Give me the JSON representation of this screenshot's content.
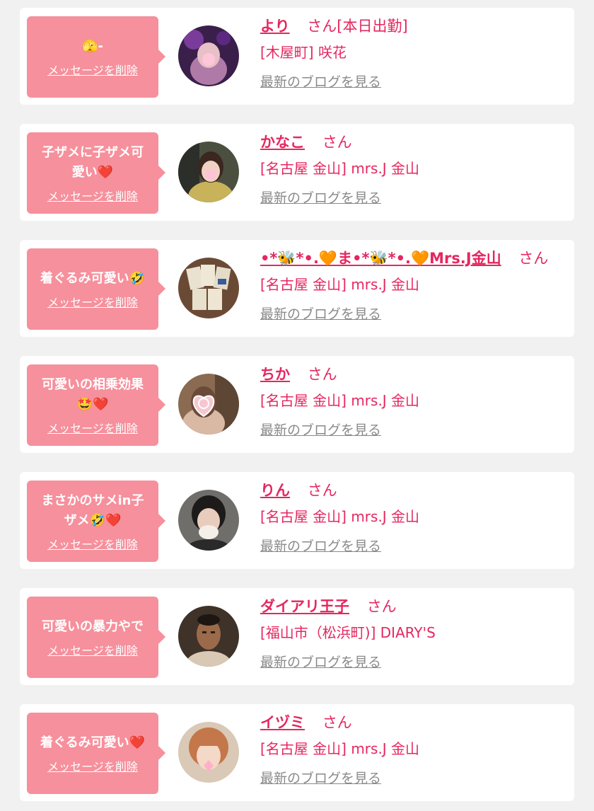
{
  "colors": {
    "accent": "#e5275f",
    "bubble": "#f6909c",
    "background": "#f1f1f1",
    "card": "#ffffff",
    "link_gray": "#8a8a8a"
  },
  "delete_label": "メッセージを削除",
  "blog_label": "最新のブログを見る",
  "san_label": "さん",
  "cards": [
    {
      "message": "🫣-",
      "name": "より",
      "name_suffix": "さん[本日出勤]",
      "shop": "[木屋町] 咲花",
      "avatar": "avatar-photo-purple"
    },
    {
      "message": "子ザメに子ザメ可愛い❤️",
      "name": "かなこ",
      "name_suffix": "さん",
      "shop": "[名古屋 金山] mrs.J 金山",
      "avatar": "avatar-photo-woman"
    },
    {
      "message": "着ぐるみ可愛い🤣",
      "name": "•*🐝*•.🧡ま•*🐝*•.🧡Mrs.J金山",
      "name_suffix": "さん",
      "shop": "[名古屋 金山] mrs.J 金山",
      "avatar": "avatar-photo-cards"
    },
    {
      "message": "可愛いの相乗効果🤩❤️",
      "name": "ちか",
      "name_suffix": "さん",
      "shop": "[名古屋 金山] mrs.J 金山",
      "avatar": "avatar-photo-heart-c"
    },
    {
      "message": "まさかのサメin子ザメ🤣❤️",
      "name": "りん",
      "name_suffix": "さん",
      "shop": "[名古屋 金山] mrs.J 金山",
      "avatar": "avatar-photo-ng"
    },
    {
      "message": "可愛いの暴力やで",
      "name": "ダイアリ王子",
      "name_suffix": "さん",
      "shop": "[福山市（松浜町)] DIARY'S",
      "avatar": "avatar-photo-man"
    },
    {
      "message": "着ぐるみ可愛い❤️",
      "name": "イヅミ",
      "name_suffix": "さん",
      "shop": "[名古屋 金山] mrs.J 金山",
      "avatar": "avatar-photo-girl"
    }
  ]
}
